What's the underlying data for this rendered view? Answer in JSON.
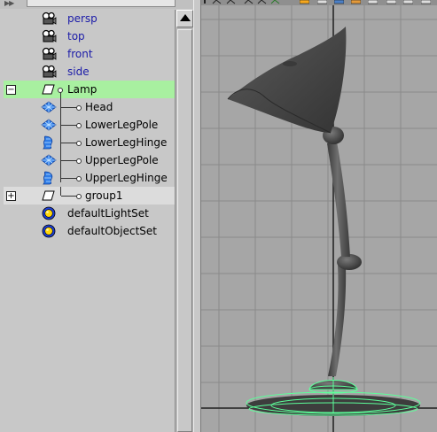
{
  "outliner": {
    "items": [
      {
        "label": "persp",
        "icon": "camera-icon",
        "kind": "camera"
      },
      {
        "label": "top",
        "icon": "camera-icon",
        "kind": "camera"
      },
      {
        "label": "front",
        "icon": "camera-icon",
        "kind": "camera"
      },
      {
        "label": "side",
        "icon": "camera-icon",
        "kind": "camera"
      },
      {
        "label": "Lamp",
        "icon": "transform-icon",
        "kind": "group",
        "expanded": true,
        "selected": true
      },
      {
        "label": "Head",
        "icon": "nurbs-surface-icon",
        "kind": "child"
      },
      {
        "label": "LowerLegPole",
        "icon": "nurbs-surface-icon",
        "kind": "child"
      },
      {
        "label": "LowerLegHinge",
        "icon": "nurbs-curve-surface-icon",
        "kind": "child"
      },
      {
        "label": "UpperLegPole",
        "icon": "nurbs-surface-icon",
        "kind": "child"
      },
      {
        "label": "UpperLegHinge",
        "icon": "nurbs-curve-surface-icon",
        "kind": "child"
      },
      {
        "label": "group1",
        "icon": "transform-icon",
        "kind": "group",
        "expanded": false
      },
      {
        "label": "defaultLightSet",
        "icon": "set-icon",
        "kind": "set"
      },
      {
        "label": "defaultObjectSet",
        "icon": "set-icon",
        "kind": "set"
      }
    ],
    "expand_open_glyph": "−",
    "expand_closed_glyph": "+",
    "topbar_arrows": "▶▶"
  },
  "viewport": {
    "background": "#a6a6a6",
    "grid_color": "#8a8a8a",
    "axis_color": "#1f1f1f",
    "selection_wire_color": "#5dff9a",
    "object": "desk lamp model"
  },
  "colors": {
    "selected_row": "#a8f0a0",
    "camera_label": "#1a1aa8"
  }
}
